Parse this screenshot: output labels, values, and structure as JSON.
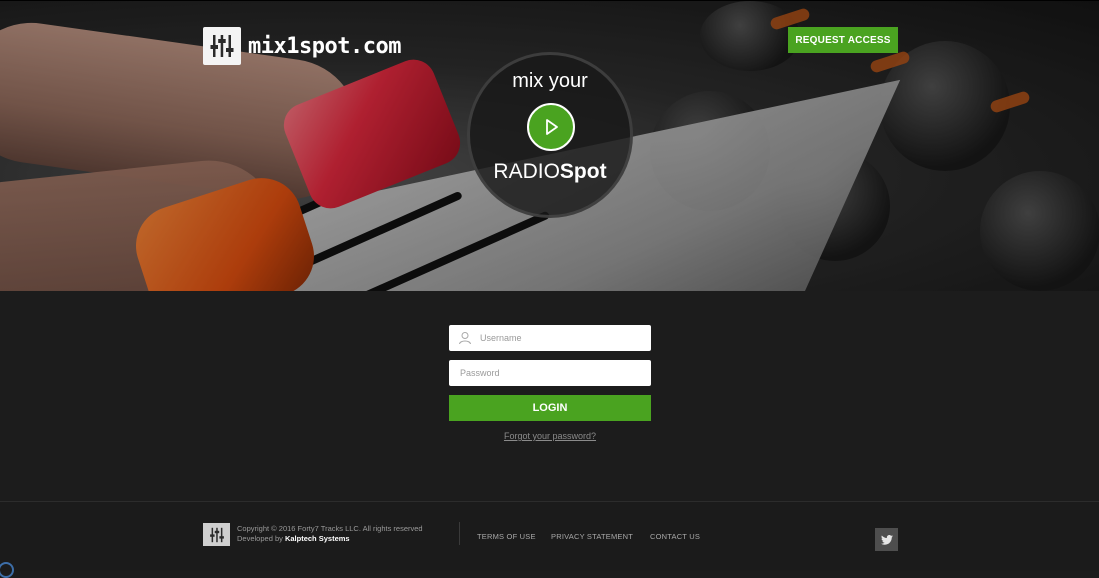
{
  "header": {
    "logo_text": "mix1spot.com",
    "request_access_label": "REQUEST ACCESS"
  },
  "badge": {
    "top_text": "mix your",
    "bottom_regular": "RADIO",
    "bottom_bold": "Spot"
  },
  "login": {
    "username_placeholder": "Username",
    "password_placeholder": "Password",
    "login_label": "LOGIN",
    "forgot_label": "Forgot your password?"
  },
  "footer": {
    "copyright": "Copyright © 2016 Forty7 Tracks LLC. All rights reserved",
    "developed_prefix": "Developed by",
    "developer": "Kalptech Systems",
    "links": [
      "TERMS OF USE",
      "PRIVACY STATEMENT",
      "CONTACT US"
    ]
  },
  "colors": {
    "accent": "#4aa320",
    "background": "#1c1c1c"
  },
  "icons": [
    "mixer-logo-icon",
    "play-icon",
    "user-icon",
    "twitter-icon"
  ]
}
